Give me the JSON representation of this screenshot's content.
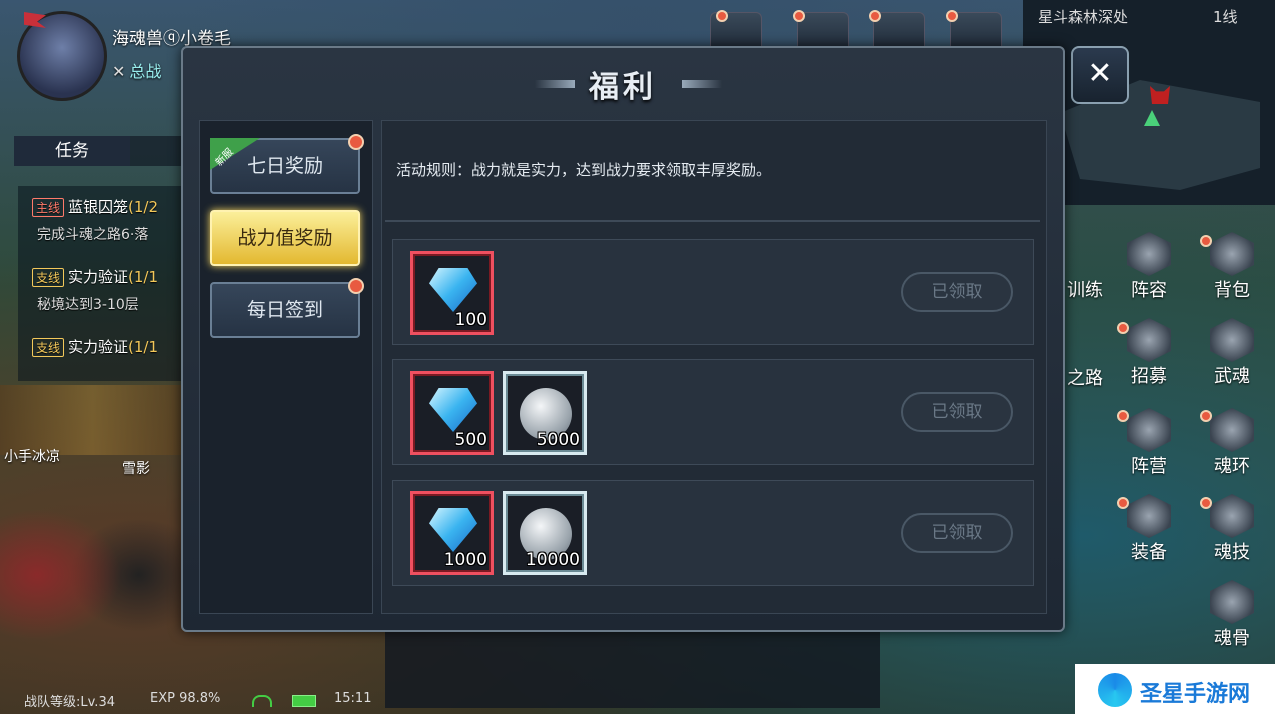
{
  "player": {
    "name": "海魂兽ⓠ小卷毛",
    "power_label": "总战"
  },
  "task_panel": {
    "tabs": [
      "任务"
    ],
    "items": [
      {
        "tag": "主线",
        "title": "蓝银囚笼",
        "progress": "(1/2",
        "desc": "完成斗魂之路6·落"
      },
      {
        "tag": "支线",
        "title": "实力验证",
        "progress": "(1/1",
        "desc": "秘境达到3-10层"
      },
      {
        "tag": "支线",
        "title": "实力验证",
        "progress": "(1/1",
        "desc": ""
      }
    ]
  },
  "banner": {
    "caption_left": "小手冰凉",
    "caption_right": "雪影"
  },
  "status_bar": {
    "level": "战队等级:Lv.34",
    "exp": "EXP 98.8%",
    "time": "15:11"
  },
  "minimap": {
    "location": "星斗森林深处",
    "line": "1线"
  },
  "right_menu": [
    "训练",
    "阵容",
    "背包",
    "之路",
    "招募",
    "武魂",
    "阵营",
    "魂环",
    "装备",
    "魂技",
    "魂骨"
  ],
  "dialog": {
    "title": "福利",
    "tabs": [
      {
        "label": "七日奖励",
        "badge": "新服",
        "active": false
      },
      {
        "label": "战力值奖励",
        "active": true
      },
      {
        "label": "每日签到",
        "active": false
      }
    ],
    "rules": "活动规则：战力就是实力，达到战力要求领取丰厚奖励。",
    "rewards": [
      {
        "items": [
          {
            "type": "diamond",
            "qty": "100"
          }
        ],
        "button": "已领取"
      },
      {
        "items": [
          {
            "type": "diamond",
            "qty": "500"
          },
          {
            "type": "coin",
            "qty": "5000"
          }
        ],
        "button": "已领取"
      },
      {
        "items": [
          {
            "type": "diamond",
            "qty": "1000"
          },
          {
            "type": "coin",
            "qty": "10000"
          }
        ],
        "button": "已领取"
      }
    ],
    "close_icon": "close-icon"
  },
  "watermark": {
    "text": "圣星手游网"
  },
  "colors": {
    "active_tab": "#f3d45a",
    "frame_red": "#ef5060",
    "reddot": "#e85a40"
  }
}
